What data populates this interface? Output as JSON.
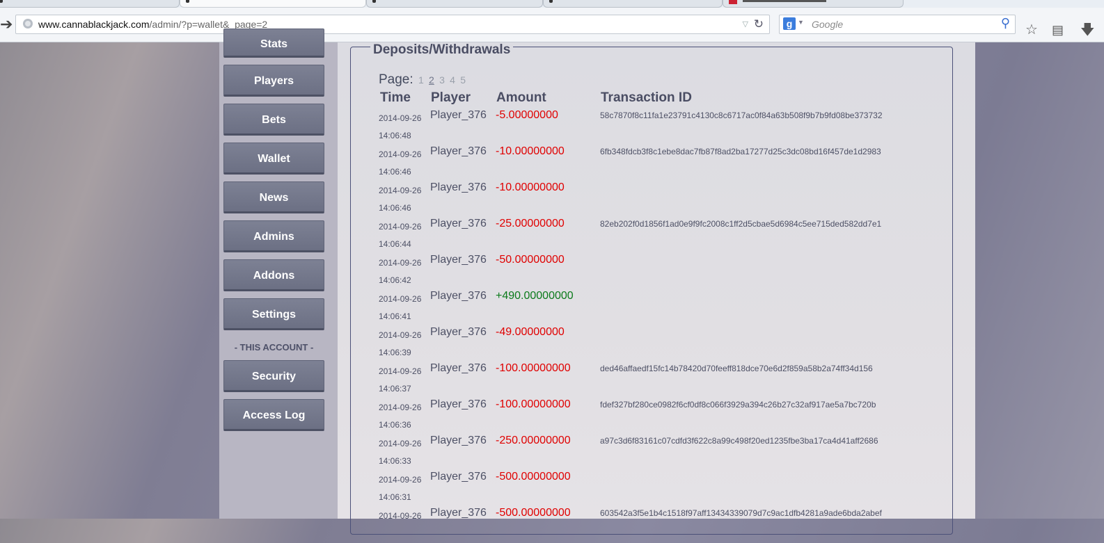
{
  "browser": {
    "url_host": "www.cannablackjack.com",
    "url_path": "/admin/?p=wallet&_page=2",
    "search_placeholder": "Google",
    "search_engine_letter": "g"
  },
  "sidebar": {
    "items": [
      {
        "label": "Stats"
      },
      {
        "label": "Players"
      },
      {
        "label": "Bets"
      },
      {
        "label": "Wallet"
      },
      {
        "label": "News"
      },
      {
        "label": "Admins"
      },
      {
        "label": "Addons"
      },
      {
        "label": "Settings"
      }
    ],
    "section_label": "- THIS ACCOUNT -",
    "account_items": [
      {
        "label": "Security"
      },
      {
        "label": "Access Log"
      }
    ]
  },
  "main": {
    "legend": "Deposits/Withdrawals",
    "pager_label": "Page:",
    "pages": [
      "1",
      "2",
      "3",
      "4",
      "5"
    ],
    "current_page": "2",
    "columns": [
      "Time",
      "Player",
      "Amount",
      "Transaction ID"
    ],
    "rows": [
      {
        "date": "2014-09-26",
        "time": "14:06:48",
        "player": "Player_376",
        "amount": "-5.00000000",
        "tx": "58c7870f8c11fa1e23791c4130c8c6717ac0f84a63b508f9b7b9fd08be373732"
      },
      {
        "date": "2014-09-26",
        "time": "14:06:46",
        "player": "Player_376",
        "amount": "-10.00000000",
        "tx": "6fb348fdcb3f8c1ebe8dac7fb87f8ad2ba17277d25c3dc08bd16f457de1d2983"
      },
      {
        "date": "2014-09-26",
        "time": "14:06:46",
        "player": "Player_376",
        "amount": "-10.00000000",
        "tx": ""
      },
      {
        "date": "2014-09-26",
        "time": "14:06:44",
        "player": "Player_376",
        "amount": "-25.00000000",
        "tx": "82eb202f0d1856f1ad0e9f9fc2008c1ff2d5cbae5d6984c5ee715ded582dd7e1"
      },
      {
        "date": "2014-09-26",
        "time": "14:06:42",
        "player": "Player_376",
        "amount": "-50.00000000",
        "tx": ""
      },
      {
        "date": "2014-09-26",
        "time": "14:06:41",
        "player": "Player_376",
        "amount": "+490.00000000",
        "tx": ""
      },
      {
        "date": "2014-09-26",
        "time": "14:06:39",
        "player": "Player_376",
        "amount": "-49.00000000",
        "tx": ""
      },
      {
        "date": "2014-09-26",
        "time": "14:06:37",
        "player": "Player_376",
        "amount": "-100.00000000",
        "tx": "ded46affaedf15fc14b78420d70feeff818dce70e6d2f859a58b2a74ff34d156"
      },
      {
        "date": "2014-09-26",
        "time": "14:06:36",
        "player": "Player_376",
        "amount": "-100.00000000",
        "tx": "fdef327bf280ce0982f6cf0df8c066f3929a394c26b27c32af917ae5a7bc720b"
      },
      {
        "date": "2014-09-26",
        "time": "14:06:33",
        "player": "Player_376",
        "amount": "-250.00000000",
        "tx": "a97c3d6f83161c07cdfd3f622c8a99c498f20ed1235fbe3ba17ca4d41aff2686"
      },
      {
        "date": "2014-09-26",
        "time": "14:06:31",
        "player": "Player_376",
        "amount": "-500.00000000",
        "tx": ""
      },
      {
        "date": "2014-09-26",
        "time": "",
        "player": "Player_376",
        "amount": "-500.00000000",
        "tx": "603542a3f5e1b4c1518f97aff13434339079d7c9ac1dfb4281a9ade6bda2abef"
      }
    ]
  },
  "colors": {
    "negative_amount": "#e00000",
    "positive_amount": "#0a7a1a",
    "menu_button": "#74788c"
  }
}
